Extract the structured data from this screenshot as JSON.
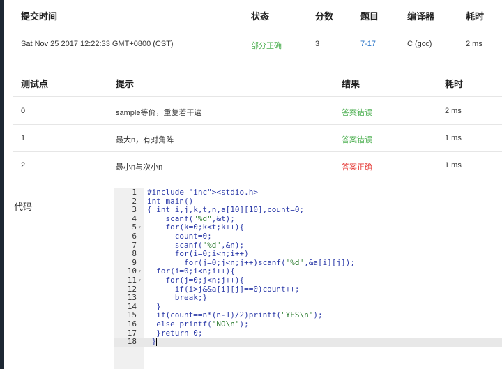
{
  "submission": {
    "headers": {
      "time": "提交时间",
      "status": "状态",
      "score": "分数",
      "problem": "题目",
      "compiler": "编译器",
      "elapsed": "耗时"
    },
    "row": {
      "time": "Sat Nov 25 2017 12:22:33 GMT+0800 (CST)",
      "status": "部分正确",
      "score": "3",
      "problem": "7-17",
      "compiler": "C (gcc)",
      "elapsed": "2 ms"
    }
  },
  "testcases": {
    "headers": {
      "id": "测试点",
      "hint": "提示",
      "result": "结果",
      "elapsed": "耗时"
    },
    "rows": [
      {
        "id": "0",
        "hint": "sample等价，重复若干遍",
        "result": "答案错误",
        "elapsed": "2 ms"
      },
      {
        "id": "1",
        "hint": "最大n，有对角阵",
        "result": "答案错误",
        "elapsed": "1 ms"
      },
      {
        "id": "2",
        "hint": "最小n与次小n",
        "result": "答案正确",
        "elapsed": "1 ms"
      }
    ]
  },
  "code": {
    "label": "代码",
    "line_numbers": [
      "1",
      "2",
      "3",
      "4",
      "5",
      "6",
      "7",
      "8",
      "9",
      "10",
      "11",
      "12",
      "13",
      "14",
      "15",
      "16",
      "17",
      "18"
    ],
    "lines": [
      "#include <stdio.h>",
      "int main()",
      "{ int i,j,k,t,n,a[10][10],count=0;",
      "    scanf(\"%d\",&t);",
      "    for(k=0;k<t;k++){",
      "      count=0;",
      "      scanf(\"%d\",&n);",
      "      for(i=0;i<n;i++)",
      "        for(j=0;j<n;j++)scanf(\"%d\",&a[i][j]);",
      "  for(i=0;i<n;i++){",
      "    for(j=0;j<n;j++){",
      "      if(i>j&&a[i][j]==0)count++;",
      "      break;}",
      "  }",
      "  if(count==n*(n-1)/2)printf(\"YES\\n\");",
      "  else printf(\"NO\\n\");",
      "  }return 0;",
      " }"
    ],
    "active_line": 18
  },
  "colors": {
    "status_partial": "#4caf50",
    "wrong": "#4caf50",
    "correct": "#e53935",
    "link": "#2d77c8"
  }
}
